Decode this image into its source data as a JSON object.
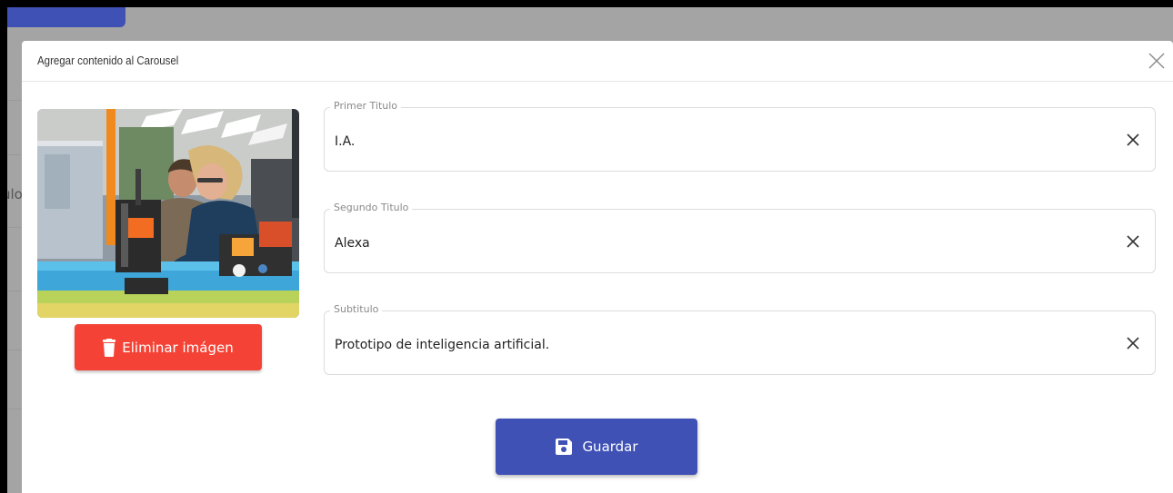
{
  "background": {
    "cut_text": "ulo"
  },
  "modal": {
    "title": "Agregar contenido al Carousel",
    "close_icon": "close-icon"
  },
  "image": {
    "delete_label": "Eliminar imágen",
    "delete_icon": "trash-icon"
  },
  "fields": [
    {
      "label": "Primer Titulo",
      "value": "I.A.",
      "clear_icon": "close-icon"
    },
    {
      "label": "Segundo Titulo",
      "value": "Alexa",
      "clear_icon": "close-icon"
    },
    {
      "label": "Subtitulo",
      "value": "Prototipo de inteligencia artificial.",
      "clear_icon": "close-icon"
    }
  ],
  "save": {
    "label": "Guardar",
    "icon": "floppy-disk-icon"
  },
  "colors": {
    "primary": "#3f51b5",
    "danger": "#f44336"
  }
}
